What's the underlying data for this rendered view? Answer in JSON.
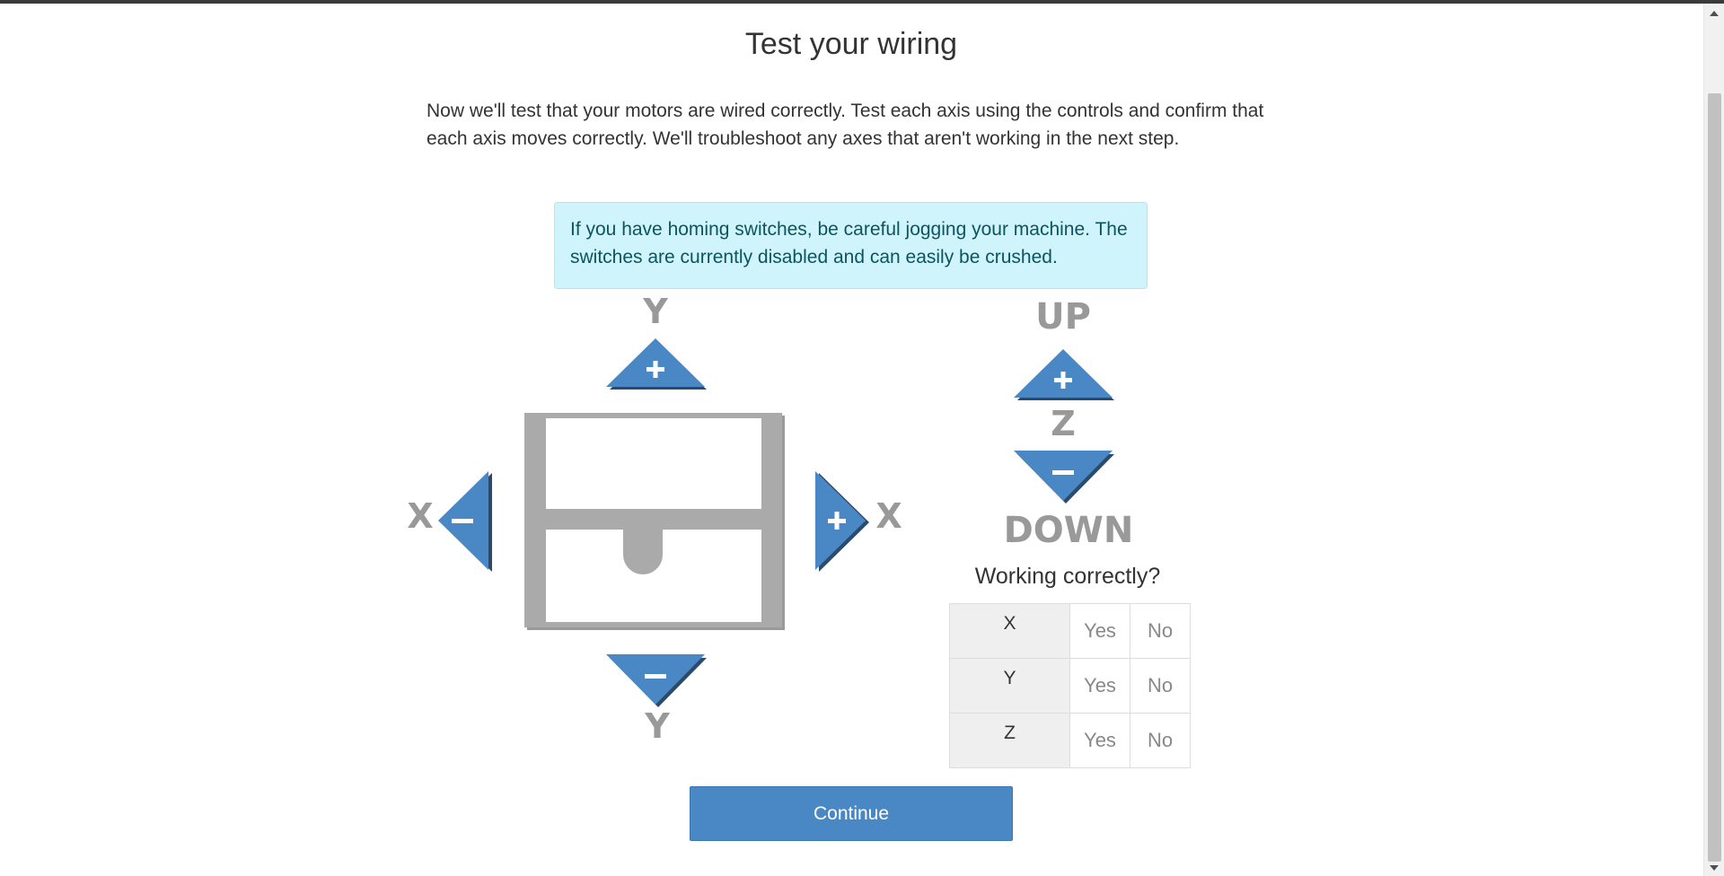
{
  "page": {
    "title": "Test your wiring",
    "intro": "Now we'll test that your motors are wired correctly. Test each axis using the controls and confirm that each axis moves correctly. We'll troubleshoot any axes that aren't working in the next step.",
    "alert": "If you have homing switches, be careful jogging your machine. The switches are currently disabled and can easily be crushed."
  },
  "jog": {
    "y_top_label": "Y",
    "y_bottom_label": "Y",
    "x_left_label": "X",
    "x_right_label": "X",
    "z_up_label": "UP",
    "z_label": "Z",
    "z_down_label": "DOWN",
    "plus_symbol": "+",
    "minus_symbol": "—"
  },
  "check": {
    "title": "Working correctly?",
    "rows": [
      {
        "axis": "X",
        "yes": "Yes",
        "no": "No"
      },
      {
        "axis": "Y",
        "yes": "Yes",
        "no": "No"
      },
      {
        "axis": "Z",
        "yes": "Yes",
        "no": "No"
      }
    ]
  },
  "continue_label": "Continue",
  "colors": {
    "button_blue": "#4a88c5",
    "button_shadow": "#2c4a6b",
    "label_gray": "#999999",
    "machine_gray": "#aaaaaa",
    "alert_bg": "#d0f4fb"
  }
}
